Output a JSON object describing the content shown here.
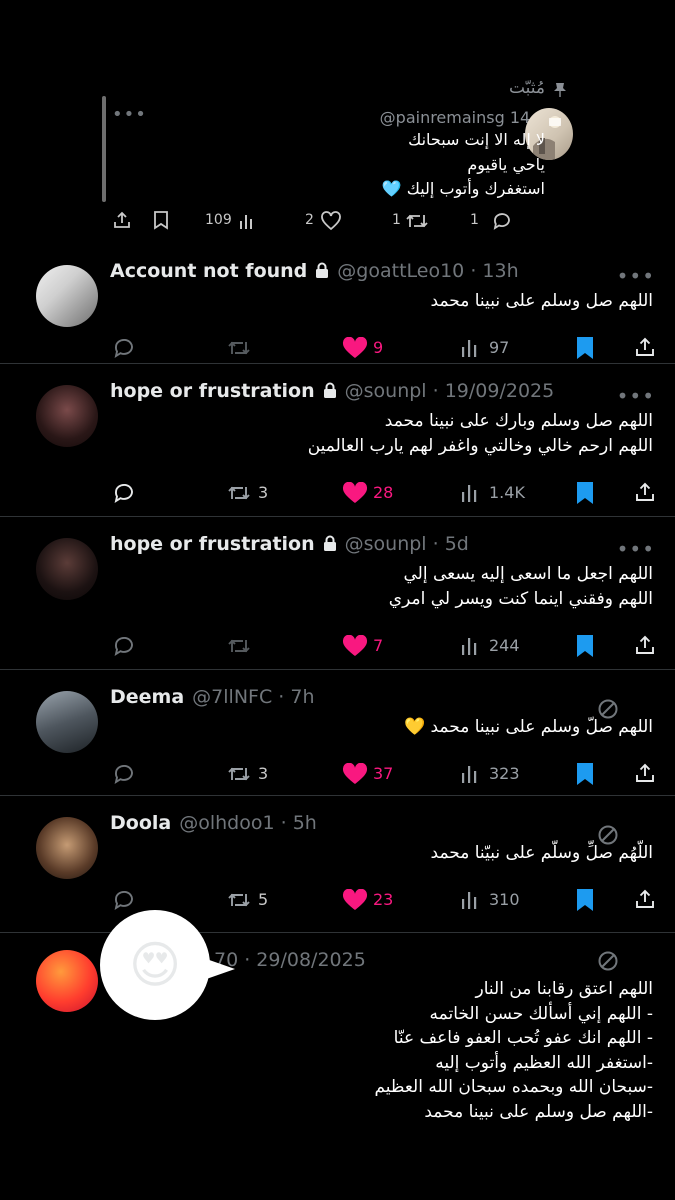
{
  "pinned": {
    "label": "مُثبّت",
    "handle": "@painremainsg",
    "time": "14 · س",
    "lines": [
      "لا إله الا إنت سبحانك",
      "ياحي ياقيوم",
      "استغفرك وأتوب إليك 🩵"
    ],
    "stats": {
      "replies": "1",
      "reposts": "1",
      "likes": "2",
      "views": "109"
    }
  },
  "posts": [
    {
      "name": "Account not found",
      "handle": "@goattLeo10",
      "time": "13h",
      "lines": [
        "اللهم صل وسلم على نبينا محمد"
      ],
      "replies": "",
      "reposts": "",
      "likes": "9",
      "views": "97"
    },
    {
      "name": "hope or frustration",
      "handle": "@sounpl",
      "time": "19/09/2025",
      "lines": [
        "اللهم صل وسلم وبارك على نبينا محمد",
        "اللهم ارحم خالي وخالتي واغفر لهم يارب العالمين"
      ],
      "replies": "",
      "reposts": "3",
      "likes": "28",
      "views": "1.4K"
    },
    {
      "name": "hope or frustration",
      "handle": "@sounpl",
      "time": "5d",
      "lines": [
        "اللهم اجعل ما اسعى إليه يسعى إلي",
        "اللهم وفقني اينما كنت ويسر لي امري"
      ],
      "replies": "",
      "reposts": "",
      "likes": "7",
      "views": "244"
    },
    {
      "name": "Deema",
      "handle": "@7llNFC",
      "time": "7h",
      "lines": [
        "اللهم صلّ وسلم على نبينا محمد 💛"
      ],
      "replies": "",
      "reposts": "3",
      "likes": "37",
      "views": "323"
    },
    {
      "name": "Doola",
      "handle": "@olhdoo1",
      "time": "5h",
      "lines": [
        "اللّهُم صلِّ وسلّم على نبيّنا محمد"
      ],
      "replies": "",
      "reposts": "5",
      "likes": "23",
      "views": "310"
    }
  ],
  "last_post": {
    "meta": "70 · 29/08/2025",
    "lines": [
      "اللهم اعتق رقابنا من النار",
      "- اللهم إني أسألك حسن الخاتمه",
      "- اللهم انك عفو تُحب العفو فاعف عنّا",
      "-استغفر الله العظيم وأتوب إليه",
      "-سبحان الله وبحمده سبحان الله العظيم",
      "-اللهم صل وسلم على نبينا محمد"
    ]
  },
  "sticker": {
    "emoji": "😍"
  },
  "colors": {
    "like": "#f91880",
    "bookmark": "#1d9bf0",
    "background": "#000000"
  }
}
